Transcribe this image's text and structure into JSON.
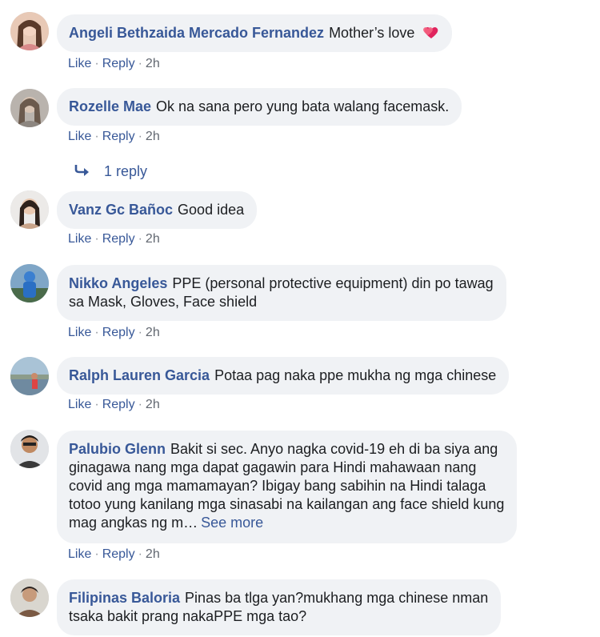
{
  "comments": [
    {
      "author": "Angeli Bethzaida Mercado Fernandez",
      "text": "Mother’s love",
      "emoji": "two-hearts-icon",
      "like": "Like",
      "reply": "Reply",
      "time": "2h"
    },
    {
      "author": "Rozelle Mae",
      "text": "Ok na sana pero yung bata walang facemask.",
      "like": "Like",
      "reply": "Reply",
      "time": "2h",
      "replies_label": "1 reply"
    },
    {
      "author": "Vanz Gc Bañoc",
      "text": "Good idea",
      "like": "Like",
      "reply": "Reply",
      "time": "2h"
    },
    {
      "author": "Nikko Angeles",
      "text_line1": "PPE (personal protective equipment) din po tawag",
      "text_line2": "sa Mask, Gloves, Face shield",
      "like": "Like",
      "reply": "Reply",
      "time": "2h"
    },
    {
      "author": "Ralph Lauren Garcia",
      "text": "Potaa pag naka ppe mukha ng mga chinese",
      "like": "Like",
      "reply": "Reply",
      "time": "2h"
    },
    {
      "author": "Palubio Glenn",
      "text_line1": "Bakit si sec. Anyo nagka covid-19 eh di ba siya ang",
      "text_line2": "ginagawa nang mga dapat gagawin para Hindi mahawaan nang",
      "text_line3": "covid ang mga mamamayan? Ibigay bang sabihin na Hindi talaga",
      "text_line4": "totoo yung kanilang mga sinasabi na kailangan ang face shield kung",
      "text_line5": "mag angkas ng m…",
      "see_more": "See more",
      "like": "Like",
      "reply": "Reply",
      "time": "2h"
    },
    {
      "author": "Filipinas Baloria",
      "text_line1": "Pinas ba tlga yan?mukhang mga chinese nman",
      "text_line2": "tsaka bakit prang nakaPPE mga tao?"
    }
  ],
  "separator": "·",
  "colors": {
    "link": "#385898",
    "bubble": "#f0f2f5",
    "heart": "#e0245e"
  }
}
